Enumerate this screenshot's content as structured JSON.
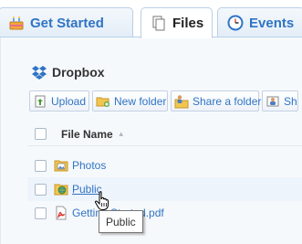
{
  "tabs": [
    {
      "label": "Get Started",
      "icon": "cake-icon",
      "active": false
    },
    {
      "label": "Files",
      "icon": "files-icon",
      "active": true
    },
    {
      "label": "Events",
      "icon": "clock-icon",
      "active": false
    }
  ],
  "page_title": "Dropbox",
  "toolbar": {
    "upload": "Upload",
    "new_folder": "New folder",
    "share_folder": "Share a folder",
    "cut_label": "Sh"
  },
  "file_list": {
    "header": "File Name",
    "sort_indicator": "▲",
    "items": [
      {
        "name": "Photos",
        "icon": "photo-folder-icon"
      },
      {
        "name": "Public",
        "icon": "public-folder-icon"
      },
      {
        "name": "Getting Started.pdf",
        "icon": "pdf-icon"
      }
    ]
  },
  "tooltip": "Public",
  "colors": {
    "link": "#2f74c4",
    "tab_border": "#b9cfe6",
    "folder": "#f2c64e"
  }
}
